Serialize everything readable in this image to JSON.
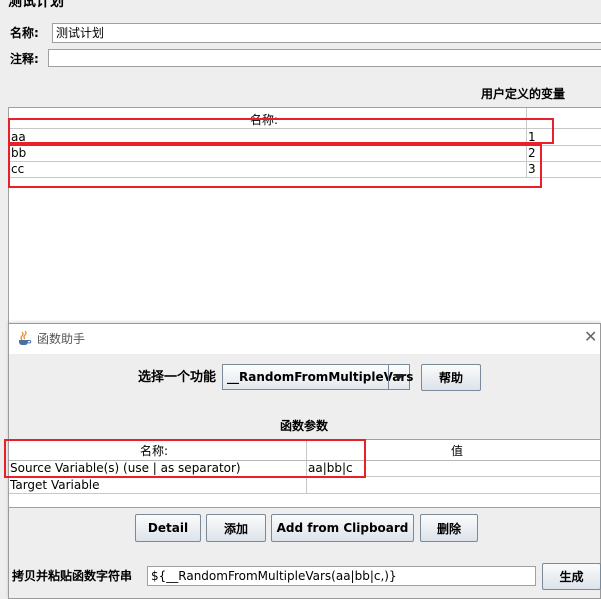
{
  "plan": {
    "heading": "测试计划",
    "name_label": "名称:",
    "name_value": "测试计划",
    "comment_label": "注释:",
    "comment_value": ""
  },
  "variables": {
    "section_title": "用户定义的变量",
    "columns": [
      "名称:",
      ""
    ],
    "rows": [
      {
        "name": "aa",
        "value": "1"
      },
      {
        "name": "bb",
        "value": "2"
      },
      {
        "name": "cc",
        "value": "3"
      }
    ]
  },
  "dialog": {
    "title": "函数助手",
    "select_label": "选择一个功能",
    "selected_function": "__RandomFromMultipleVars",
    "help_button": "帮助",
    "params_title": "函数参数",
    "columns": [
      "名称:",
      "值"
    ],
    "rows": [
      {
        "name": "Source Variable(s) (use | as separator)",
        "value": "aa|bb|c"
      },
      {
        "name": "Target Variable",
        "value": ""
      }
    ],
    "buttons": {
      "detail": "Detail",
      "add": "添加",
      "add_clipboard": "Add from Clipboard",
      "delete": "删除"
    },
    "copy_label": "拷贝并粘贴函数字符串",
    "function_string": "${__RandomFromMultipleVars(aa|bb|c,)}",
    "generate_button": "生成"
  },
  "colors": {
    "highlight": "#e8202a",
    "background": "#eeeeee"
  }
}
